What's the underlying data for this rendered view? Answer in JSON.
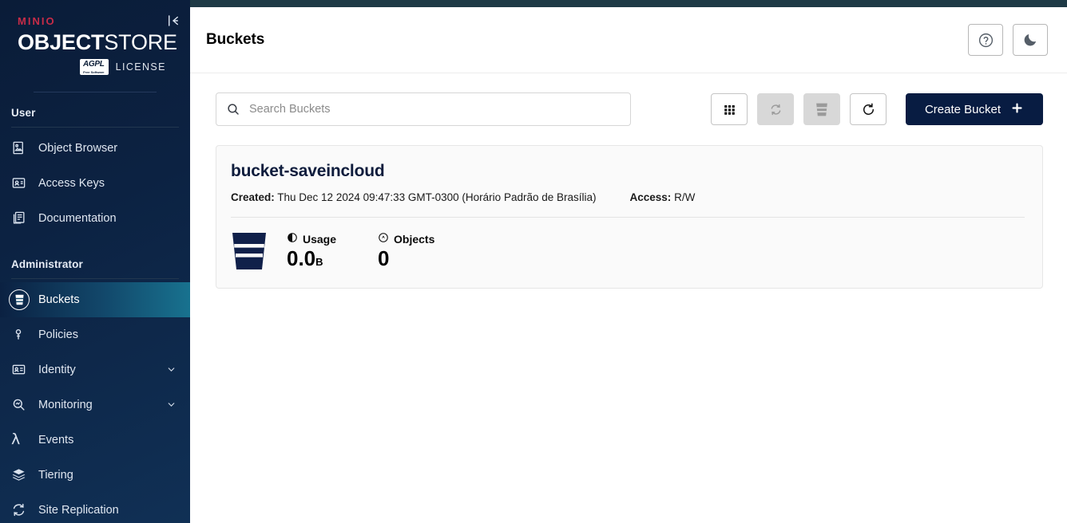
{
  "sidebar": {
    "logo": {
      "brand": "MINIO",
      "title_bold": "OBJECT",
      "title_light": "STORE",
      "badge": "AGPL",
      "badge_sub": "Free Software",
      "license_label": "LICENSE"
    },
    "collapse_icon": "collapse-sidebar-icon",
    "sections": [
      {
        "label": "User",
        "items": [
          {
            "label": "Object Browser",
            "icon": "object-browser-icon",
            "active": false,
            "expandable": false
          },
          {
            "label": "Access Keys",
            "icon": "access-keys-icon",
            "active": false,
            "expandable": false
          },
          {
            "label": "Documentation",
            "icon": "documentation-icon",
            "active": false,
            "expandable": false
          }
        ]
      },
      {
        "label": "Administrator",
        "items": [
          {
            "label": "Buckets",
            "icon": "bucket-icon",
            "active": true,
            "expandable": false
          },
          {
            "label": "Policies",
            "icon": "policies-icon",
            "active": false,
            "expandable": false
          },
          {
            "label": "Identity",
            "icon": "identity-icon",
            "active": false,
            "expandable": true
          },
          {
            "label": "Monitoring",
            "icon": "monitoring-icon",
            "active": false,
            "expandable": true
          },
          {
            "label": "Events",
            "icon": "events-lambda-icon",
            "active": false,
            "expandable": false
          },
          {
            "label": "Tiering",
            "icon": "tiering-icon",
            "active": false,
            "expandable": false
          },
          {
            "label": "Site Replication",
            "icon": "site-replication-icon",
            "active": false,
            "expandable": false
          }
        ]
      }
    ]
  },
  "header": {
    "title": "Buckets",
    "help_icon": "help-circle-icon",
    "theme_icon": "dark-mode-moon-icon"
  },
  "toolbar": {
    "search_placeholder": "Search Buckets",
    "search_value": "",
    "search_icon": "search-icon",
    "buttons": [
      {
        "name": "grid-view-button",
        "icon": "grid-icon",
        "disabled": false
      },
      {
        "name": "set-replication-button",
        "icon": "replication-icon",
        "disabled": true
      },
      {
        "name": "delete-buckets-button",
        "icon": "bucket-delete-icon",
        "disabled": true
      },
      {
        "name": "refresh-button",
        "icon": "refresh-icon",
        "disabled": false
      }
    ],
    "create_label": "Create Bucket",
    "create_icon": "plus-icon"
  },
  "buckets": [
    {
      "name": "bucket-saveincloud",
      "created_label": "Created:",
      "created_value": "Thu Dec 12 2024 09:47:33 GMT-0300 (Horário Padrão de Brasília)",
      "access_label": "Access:",
      "access_value": "R/W",
      "usage_label": "Usage",
      "usage_value": "0.0",
      "usage_unit": "B",
      "objects_label": "Objects",
      "objects_value": "0"
    }
  ],
  "colors": {
    "sidebar_dark": "#0a1c38",
    "active_teal": "#18728f",
    "brand_red": "#c72c48",
    "create_navy": "#081c42",
    "top_strip": "#1e3a46",
    "bucket_name": "#0e1c3c"
  }
}
